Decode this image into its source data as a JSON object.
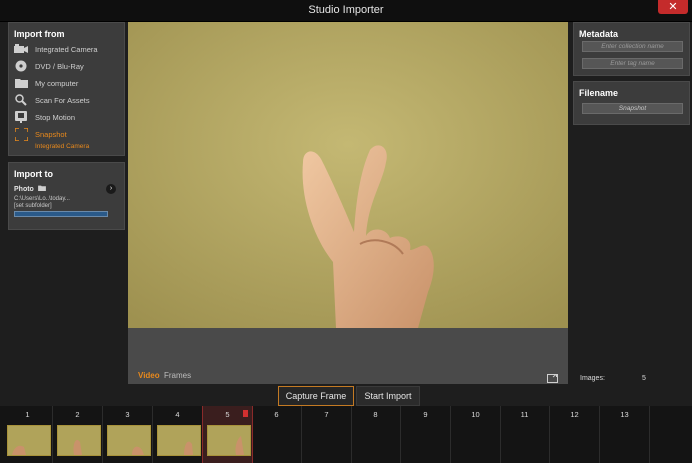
{
  "window": {
    "title": "Studio Importer",
    "close_label": "✕"
  },
  "import_from": {
    "heading": "Import from",
    "items": [
      {
        "label": "Integrated Camera",
        "icon": "camera-icon"
      },
      {
        "label": "DVD / Blu-Ray",
        "icon": "disc-icon"
      },
      {
        "label": "My computer",
        "icon": "folder-icon"
      },
      {
        "label": "Scan For Assets",
        "icon": "search-icon"
      },
      {
        "label": "Stop Motion",
        "icon": "stop-motion-icon"
      },
      {
        "label": "Snapshot",
        "icon": "snapshot-icon",
        "active": true
      }
    ],
    "snapshot_source": "Integrated Camera"
  },
  "import_to": {
    "heading": "Import to",
    "destination": "Photo",
    "path": "C:\\Users\\Lo..\\today...",
    "subfolder": "[set subfolder]"
  },
  "metadata": {
    "heading": "Metadata",
    "collection_placeholder": "Enter collection name",
    "tag_placeholder": "Enter tag name"
  },
  "filename": {
    "heading": "Filename",
    "value": "Snapshot"
  },
  "images": {
    "label": "Images:",
    "count": "5"
  },
  "view_tabs": {
    "video": "Video",
    "frames": "Frames"
  },
  "buttons": {
    "capture": "Capture Frame",
    "start": "Start Import"
  },
  "filmstrip": {
    "slots": [
      "1",
      "2",
      "3",
      "4",
      "5",
      "6",
      "7",
      "8",
      "9",
      "10",
      "11",
      "12",
      "13"
    ],
    "filled_count": 5,
    "selected": "5"
  },
  "colors": {
    "accent": "#e8891c",
    "panel": "#3c3c3c",
    "preview_wall": "#b8ab66"
  }
}
